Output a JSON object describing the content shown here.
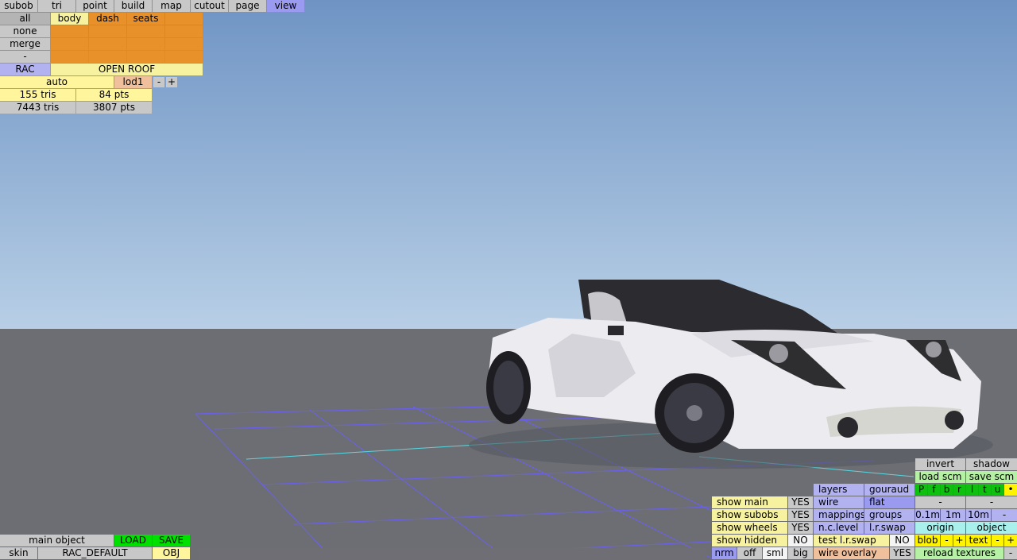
{
  "menu_tabs": [
    "subob",
    "tri",
    "point",
    "build",
    "map",
    "cutout",
    "page",
    "view"
  ],
  "active_tab": "view",
  "subobject_panel": {
    "left_buttons": [
      "all",
      "none",
      "merge",
      "-"
    ],
    "columns": [
      "body",
      "dash",
      "seats"
    ],
    "name_button": "RAC",
    "open_roof": "OPEN ROOF",
    "lod_mode": "auto",
    "lod_level": "lod1",
    "lod_minus": "-",
    "lod_plus": "+",
    "sel_tris": "155 tris",
    "sel_pts": "84 pts",
    "total_tris": "7443 tris",
    "total_pts": "3807 pts"
  },
  "bottom_left": {
    "main_object": "main object",
    "load": "LOAD",
    "save": "SAVE",
    "skin_label": "skin",
    "skin_value": "RAC_DEFAULT",
    "obj": "OBJ"
  },
  "view_panel": {
    "show_main": "show main",
    "show_main_val": "YES",
    "show_subobs": "show subobs",
    "show_subobs_val": "YES",
    "show_wheels": "show wheels",
    "show_wheels_val": "YES",
    "show_hidden": "show hidden",
    "show_hidden_val": "NO",
    "nrm": "nrm",
    "off": "off",
    "sml": "sml",
    "big": "big",
    "layers": "layers",
    "gouraud": "gouraud",
    "wire": "wire",
    "flat": "flat",
    "mappings": "mappings",
    "groups": "groups",
    "nc_level": "n.c.level",
    "lr_swap": "l.r.swap",
    "test_lr_swap": "test l.r.swap",
    "test_lr_swap_val": "NO",
    "wire_overlay": "wire overlay",
    "wire_overlay_val": "YES",
    "invert": "invert",
    "shadow": "shadow",
    "load_scm": "load scm",
    "save_scm": "save scm",
    "views": [
      "P",
      "f",
      "b",
      "r",
      "l",
      "t",
      "u",
      "•"
    ],
    "minus1": "-",
    "minus2": "-",
    "grid_01": "0.1m",
    "grid_1": "1m",
    "grid_10": "10m",
    "grid_minus": "-",
    "origin": "origin",
    "object": "object",
    "blob": "blob",
    "blob_minus": "-",
    "blob_plus": "+",
    "text": "text",
    "text_minus": "-",
    "text_plus": "+",
    "reload_textures": "reload textures",
    "last_minus": "-"
  },
  "colors": {
    "sky_top": "#6f94c4",
    "sky_bottom": "#b8cfe6",
    "ground": "#6d6e73",
    "grid": "#6a60f0",
    "grid_axis": "#58d8e0",
    "car_body": "#ececf0"
  }
}
